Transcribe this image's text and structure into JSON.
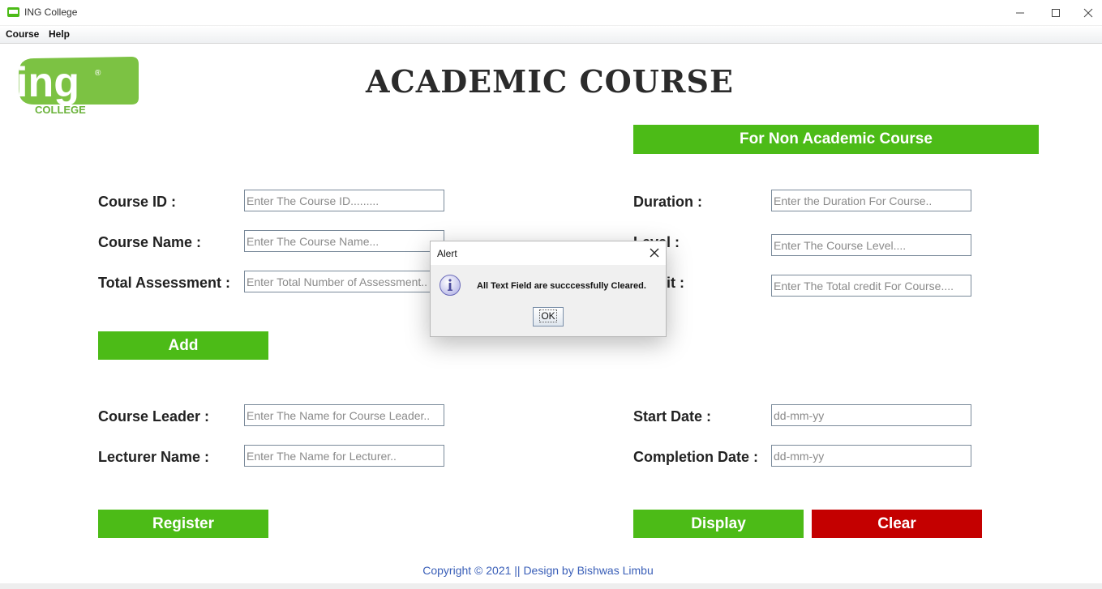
{
  "window": {
    "title": "ING College"
  },
  "menu": {
    "items": [
      "Course",
      "Help"
    ]
  },
  "logo": {
    "main_text": "ing",
    "sub_text": "COLLEGE",
    "reg_mark": "®"
  },
  "page": {
    "heading": "ACADEMIC COURSE"
  },
  "buttons": {
    "non_academic": "For Non Academic Course",
    "add": "Add",
    "register": "Register",
    "display": "Display",
    "clear": "Clear"
  },
  "form_left": [
    {
      "label": "Course ID :",
      "placeholder": "Enter The Course ID........."
    },
    {
      "label": "Course Name :",
      "placeholder": "Enter The Course Name..."
    },
    {
      "label": "Total Assessment :",
      "placeholder": "Enter Total Number of  Assessment.."
    }
  ],
  "form_right": [
    {
      "label": "Duration :",
      "placeholder": "Enter the Duration For Course.."
    },
    {
      "label": "Level :",
      "placeholder": "Enter The Course Level...."
    },
    {
      "label": "Credit :",
      "placeholder": "Enter The Total credit For Course...."
    }
  ],
  "form_bottom_left": [
    {
      "label": "Course Leader :",
      "placeholder": "Enter The Name for Course Leader.."
    },
    {
      "label": "Lecturer Name :",
      "placeholder": "Enter The Name for Lecturer.."
    }
  ],
  "form_bottom_right": [
    {
      "label": "Start Date :",
      "placeholder": "dd-mm-yy"
    },
    {
      "label": "Completion Date :",
      "placeholder": "dd-mm-yy"
    }
  ],
  "footer": {
    "text": "Copyright © 2021 || Design by Bishwas Limbu"
  },
  "dialog": {
    "title": "Alert",
    "message": "All Text Field are succcessfully Cleared.",
    "ok_label": "OK"
  },
  "colors": {
    "green": "#4cbb17",
    "red": "#c40000",
    "footer_blue": "#3a5fb8"
  },
  "icons": [
    "app-icon",
    "minimize-icon",
    "maximize-icon",
    "close-icon",
    "info-icon"
  ]
}
